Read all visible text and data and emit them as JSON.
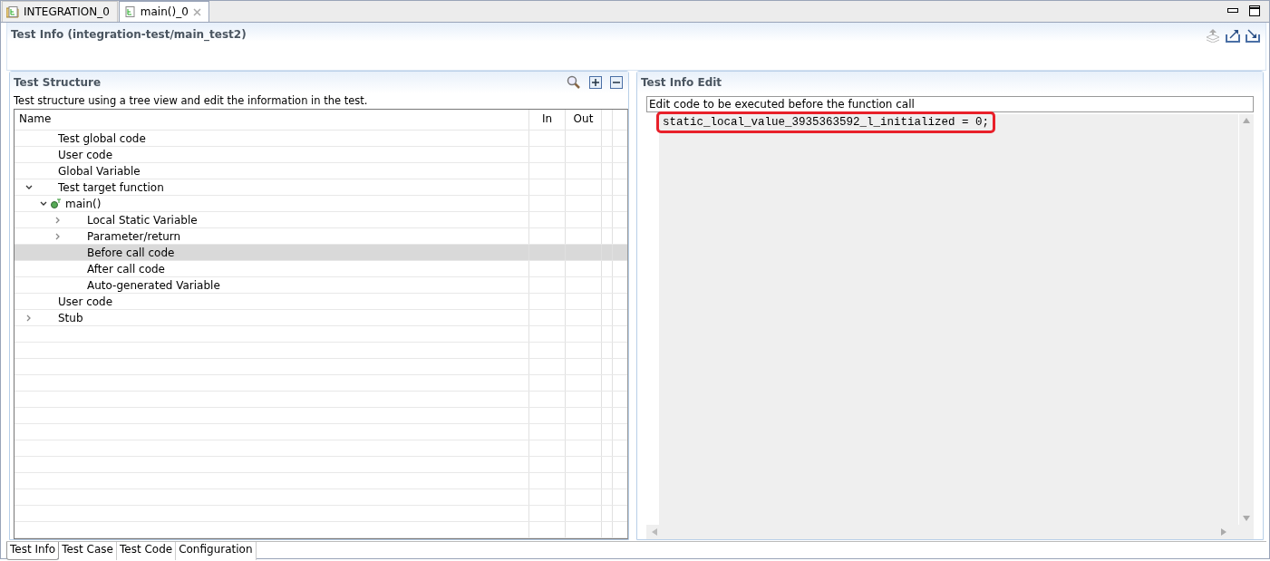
{
  "editor_tabs": [
    {
      "label": "INTEGRATION_0",
      "selected": false
    },
    {
      "label": "main()_0",
      "selected": true
    }
  ],
  "page_title": "Test Info (integration-test/main_test2)",
  "structure_panel": {
    "title": "Test Structure",
    "description": "Test structure using a tree view and edit the information in the test.",
    "columns": [
      "Name",
      "In",
      "Out"
    ],
    "tree": [
      {
        "label": "Test global code",
        "selected": false
      },
      {
        "label": "User code",
        "selected": false
      },
      {
        "label": "Global Variable",
        "selected": false
      },
      {
        "label": "Test target function",
        "selected": false,
        "expanded": true,
        "children": [
          {
            "label": "main()",
            "selected": false,
            "expanded": true,
            "kind": "function",
            "children": [
              {
                "label": "Local Static Variable",
                "selected": false,
                "expanded": false
              },
              {
                "label": "Parameter/return",
                "selected": false,
                "expanded": false
              },
              {
                "label": "Before call code",
                "selected": true
              },
              {
                "label": "After call code",
                "selected": false
              },
              {
                "label": "Auto-generated Variable",
                "selected": false
              }
            ]
          }
        ]
      },
      {
        "label": "User code",
        "selected": false
      },
      {
        "label": "Stub",
        "selected": false,
        "expanded": false
      }
    ]
  },
  "edit_panel": {
    "title": "Test Info Edit",
    "caption": "Edit code to be executed before the function call",
    "code_lines": [
      {
        "text": "static_local_value_3935363592_l_initialized = 0;",
        "highlighted": true
      }
    ]
  },
  "bottom_tabs": [
    {
      "label": "Test Info",
      "selected": true
    },
    {
      "label": "Test Case",
      "selected": false
    },
    {
      "label": "Test Code",
      "selected": false
    },
    {
      "label": "Configuration",
      "selected": false
    }
  ]
}
